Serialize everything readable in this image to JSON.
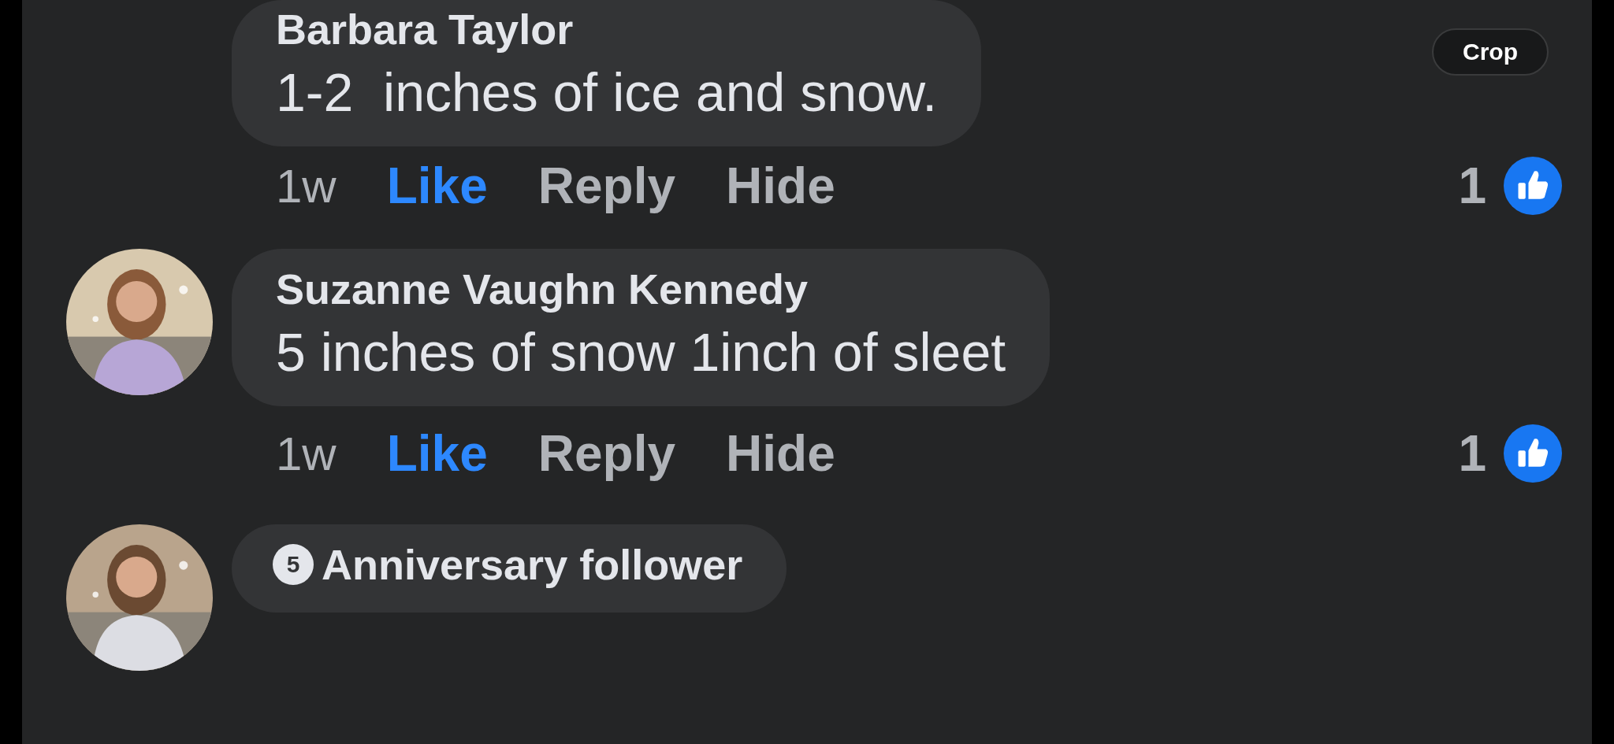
{
  "crop_button": {
    "label": "Crop"
  },
  "comments": [
    {
      "author": "Barbara Taylor",
      "text": "1-2  inches of ice and snow.",
      "time": "1w",
      "like": {
        "label": "Like",
        "selected": true
      },
      "reply": "Reply",
      "hide": "Hide",
      "reaction_count": "1"
    },
    {
      "author": "Suzanne Vaughn Kennedy",
      "text": "5 inches of snow 1inch of sleet",
      "time": "1w",
      "like": {
        "label": "Like",
        "selected": true
      },
      "reply": "Reply",
      "hide": "Hide",
      "reaction_count": "1"
    },
    {
      "badge": {
        "number": "5",
        "label": "Anniversary follower"
      }
    }
  ]
}
